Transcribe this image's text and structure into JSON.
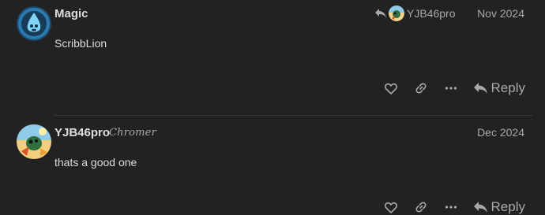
{
  "posts": [
    {
      "username": "Magic",
      "date": "Nov 2024",
      "reply_to": "YJB46pro",
      "body": "ScribbLion",
      "reply_label": "Reply"
    },
    {
      "username": "YJB46pro",
      "flair": "Chromer",
      "date": "Dec 2024",
      "body": "thats a good one",
      "reply_label": "Reply"
    }
  ],
  "colors": {
    "background": "#222222",
    "text": "#dddddd",
    "muted": "#a8a8a8"
  }
}
